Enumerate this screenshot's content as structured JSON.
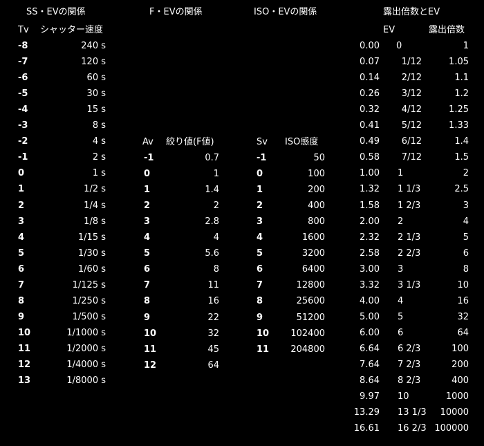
{
  "ss": {
    "title": "SS・EVの関係",
    "col_tv": "Tv",
    "col_speed": "シャッター速度",
    "rows": [
      {
        "tv": "-8",
        "speed": "240 s"
      },
      {
        "tv": "-7",
        "speed": "120 s"
      },
      {
        "tv": "-6",
        "speed": "60 s"
      },
      {
        "tv": "-5",
        "speed": "30 s"
      },
      {
        "tv": "-4",
        "speed": "15 s"
      },
      {
        "tv": "-3",
        "speed": "8 s"
      },
      {
        "tv": "-2",
        "speed": "4 s"
      },
      {
        "tv": "-1",
        "speed": "2 s"
      },
      {
        "tv": "0",
        "speed": "1 s"
      },
      {
        "tv": "1",
        "speed": "1/2 s"
      },
      {
        "tv": "2",
        "speed": "1/4 s"
      },
      {
        "tv": "3",
        "speed": "1/8 s"
      },
      {
        "tv": "4",
        "speed": "1/15 s"
      },
      {
        "tv": "5",
        "speed": "1/30 s"
      },
      {
        "tv": "6",
        "speed": "1/60 s"
      },
      {
        "tv": "7",
        "speed": "1/125 s"
      },
      {
        "tv": "8",
        "speed": "1/250 s"
      },
      {
        "tv": "9",
        "speed": "1/500 s"
      },
      {
        "tv": "10",
        "speed": "1/1000 s"
      },
      {
        "tv": "11",
        "speed": "1/2000 s"
      },
      {
        "tv": "12",
        "speed": "1/4000 s"
      },
      {
        "tv": "13",
        "speed": "1/8000 s"
      }
    ]
  },
  "f": {
    "title": "F・EVの関係",
    "col_av": "Av",
    "col_fnum": "絞り値(F値)",
    "rows": [
      {
        "av": "-1",
        "fnum": "0.7"
      },
      {
        "av": "0",
        "fnum": "1"
      },
      {
        "av": "1",
        "fnum": "1.4"
      },
      {
        "av": "2",
        "fnum": "2"
      },
      {
        "av": "3",
        "fnum": "2.8"
      },
      {
        "av": "4",
        "fnum": "4"
      },
      {
        "av": "5",
        "fnum": "5.6"
      },
      {
        "av": "6",
        "fnum": "8"
      },
      {
        "av": "7",
        "fnum": "11"
      },
      {
        "av": "8",
        "fnum": "16"
      },
      {
        "av": "9",
        "fnum": "22"
      },
      {
        "av": "10",
        "fnum": "32"
      },
      {
        "av": "11",
        "fnum": "45"
      },
      {
        "av": "12",
        "fnum": "64"
      }
    ]
  },
  "iso": {
    "title": "ISO・EVの関係",
    "col_sv": "Sv",
    "col_iso": "ISO感度",
    "rows": [
      {
        "sv": "-1",
        "iso": "50"
      },
      {
        "sv": "0",
        "iso": "100"
      },
      {
        "sv": "1",
        "iso": "200"
      },
      {
        "sv": "2",
        "iso": "400"
      },
      {
        "sv": "3",
        "iso": "800"
      },
      {
        "sv": "4",
        "iso": "1600"
      },
      {
        "sv": "5",
        "iso": "3200"
      },
      {
        "sv": "6",
        "iso": "6400"
      },
      {
        "sv": "7",
        "iso": "12800"
      },
      {
        "sv": "8",
        "iso": "25600"
      },
      {
        "sv": "9",
        "iso": "51200"
      },
      {
        "sv": "10",
        "iso": "102400"
      },
      {
        "sv": "11",
        "iso": "204800"
      }
    ]
  },
  "exp": {
    "title": "露出倍数とEV",
    "col_ev": "EV",
    "col_mult": "露出倍数",
    "rows": [
      {
        "dec": "0.00",
        "ev": "0",
        "mult": "1"
      },
      {
        "dec": "0.07",
        "ev": "1/12",
        "mult": "1.05"
      },
      {
        "dec": "0.14",
        "ev": "2/12",
        "mult": "1.1"
      },
      {
        "dec": "0.26",
        "ev": "3/12",
        "mult": "1.2"
      },
      {
        "dec": "0.32",
        "ev": "4/12",
        "mult": "1.25"
      },
      {
        "dec": "0.41",
        "ev": "5/12",
        "mult": "1.33"
      },
      {
        "dec": "0.49",
        "ev": "6/12",
        "mult": "1.4"
      },
      {
        "dec": "0.58",
        "ev": "7/12",
        "mult": "1.5"
      },
      {
        "dec": "1.00",
        "ev": "1",
        "mult": "2"
      },
      {
        "dec": "1.32",
        "ev": "1 1/3",
        "mult": "2.5"
      },
      {
        "dec": "1.58",
        "ev": "1 2/3",
        "mult": "3"
      },
      {
        "dec": "2.00",
        "ev": "2",
        "mult": "4"
      },
      {
        "dec": "2.32",
        "ev": "2 1/3",
        "mult": "5"
      },
      {
        "dec": "2.58",
        "ev": "2 2/3",
        "mult": "6"
      },
      {
        "dec": "3.00",
        "ev": "3",
        "mult": "8"
      },
      {
        "dec": "3.32",
        "ev": "3 1/3",
        "mult": "10"
      },
      {
        "dec": "4.00",
        "ev": "4",
        "mult": "16"
      },
      {
        "dec": "5.00",
        "ev": "5",
        "mult": "32"
      },
      {
        "dec": "6.00",
        "ev": "6",
        "mult": "64"
      },
      {
        "dec": "6.64",
        "ev": "6 2/3",
        "mult": "100"
      },
      {
        "dec": "7.64",
        "ev": "7 2/3",
        "mult": "200"
      },
      {
        "dec": "8.64",
        "ev": "8 2/3",
        "mult": "400"
      },
      {
        "dec": "9.97",
        "ev": "10",
        "mult": "1000"
      },
      {
        "dec": "13.29",
        "ev": "13 1/3",
        "mult": "10000"
      },
      {
        "dec": "16.61",
        "ev": "16 2/3",
        "mult": "100000"
      }
    ]
  }
}
